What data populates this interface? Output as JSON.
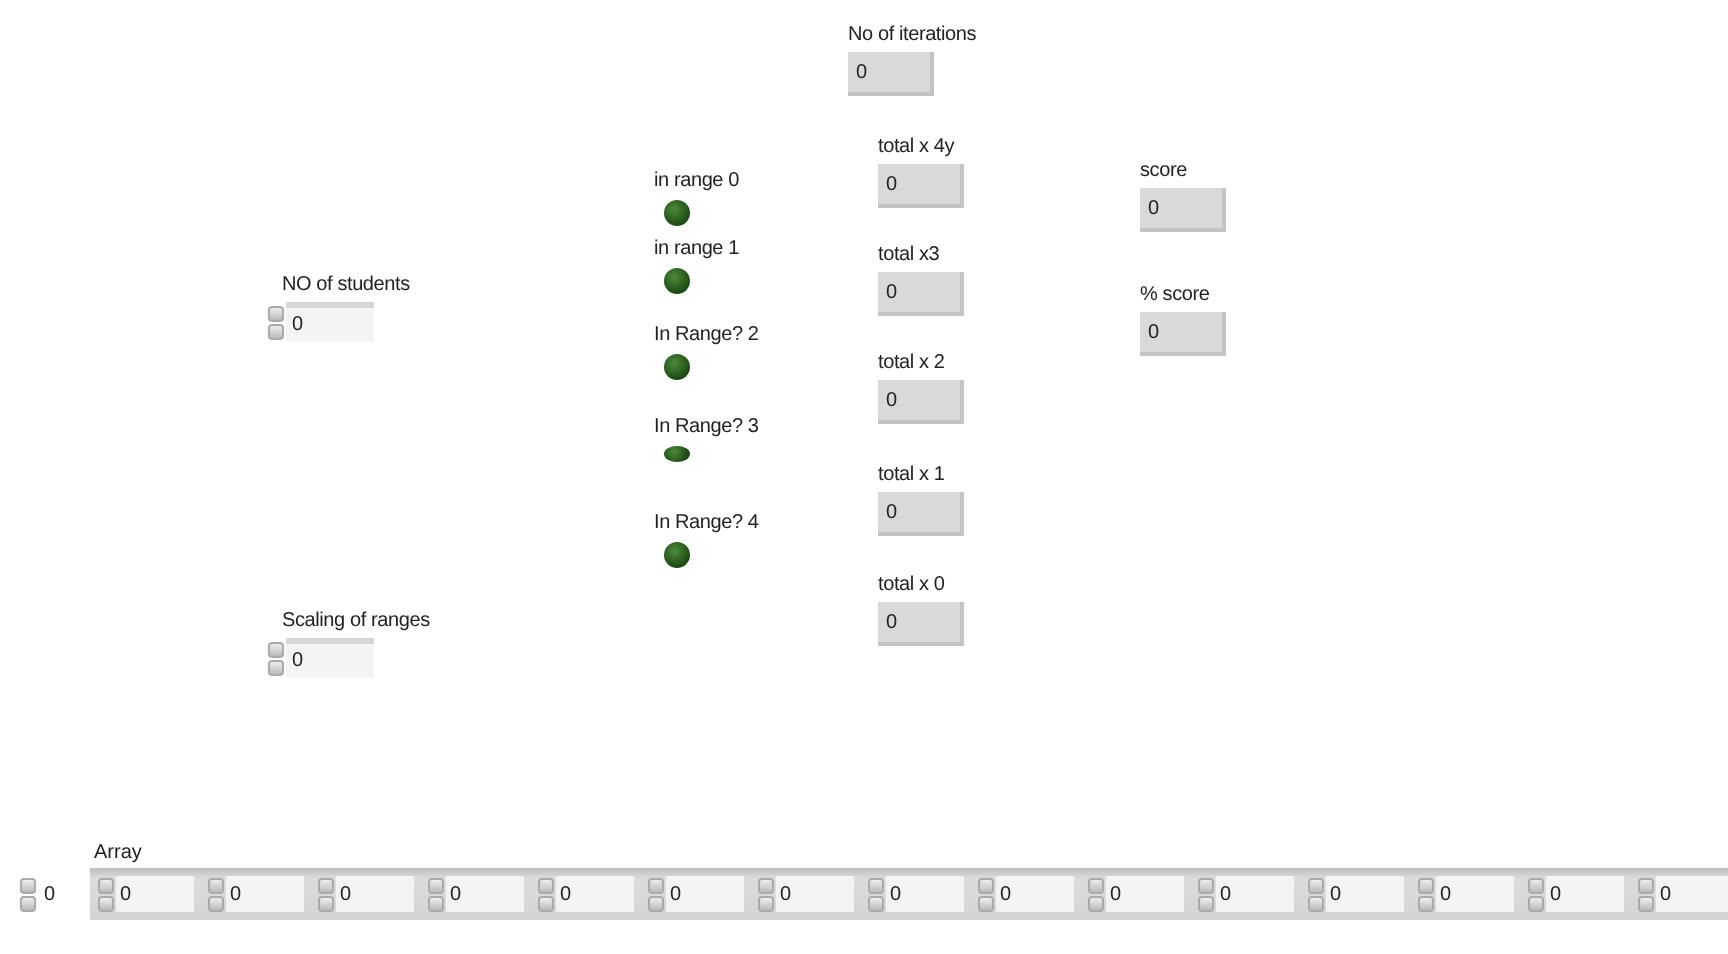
{
  "controls": [
    {
      "kind": "control",
      "label": "NO of students",
      "value": "0"
    },
    {
      "kind": "control",
      "label": "Scaling of ranges",
      "value": "0"
    },
    {
      "kind": "led",
      "label": "in range 0",
      "on": false
    },
    {
      "kind": "led",
      "label": "in range 1",
      "on": false
    },
    {
      "kind": "led",
      "label": "In Range? 2",
      "on": false
    },
    {
      "kind": "led",
      "label": "In Range? 3",
      "on": false
    },
    {
      "kind": "led",
      "label": "In Range? 4",
      "on": false
    },
    {
      "kind": "indicator",
      "label": "No of iterations",
      "value": "0"
    },
    {
      "kind": "indicator",
      "label": "total x 4y",
      "value": "0"
    },
    {
      "kind": "indicator",
      "label": "total x3",
      "value": "0"
    },
    {
      "kind": "indicator",
      "label": "total x 2",
      "value": "0"
    },
    {
      "kind": "indicator",
      "label": "total x 1",
      "value": "0"
    },
    {
      "kind": "indicator",
      "label": "total x 0",
      "value": "0"
    },
    {
      "kind": "indicator",
      "label": "score",
      "value": "0"
    },
    {
      "kind": "indicator",
      "label": "% score",
      "value": "0"
    }
  ],
  "array": {
    "label": "Array",
    "index": "0",
    "elements": [
      "0",
      "0",
      "0",
      "0",
      "0",
      "0",
      "0",
      "0",
      "0",
      "0",
      "0",
      "0",
      "0",
      "0",
      "0"
    ]
  }
}
